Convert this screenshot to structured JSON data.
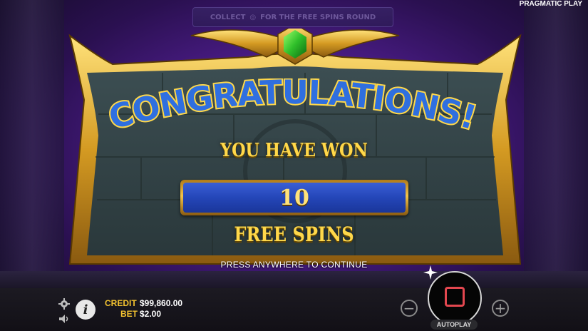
{
  "brand": "PRAGMATIC PLAY",
  "top_banner": {
    "text_left": "COLLECT",
    "text_right": "FOR THE FREE SPINS ROUND"
  },
  "popup": {
    "title": "CONGRATULATIONS!",
    "won_label": "YOU HAVE WON",
    "free_spins_count": "10",
    "free_spins_label": "FREE SPINS",
    "continue_hint": "PRESS ANYWHERE TO CONTINUE"
  },
  "bottom_bar": {
    "credit_label": "CREDIT",
    "credit_value": "$99,860.00",
    "bet_label": "BET",
    "bet_value": "$2.00",
    "info_label": "i",
    "minus_label": "−",
    "plus_label": "+",
    "autoplay_label": "AUTOPLAY",
    "icons": [
      "gear-icon",
      "sound-icon",
      "info-icon",
      "stop-icon"
    ]
  },
  "colors": {
    "gold": "#ffd84a",
    "count_blue": "#2446b8",
    "title_blue": "#2f6fe0",
    "stop_red": "#e3474f",
    "background_purple": "#4a1c86"
  }
}
